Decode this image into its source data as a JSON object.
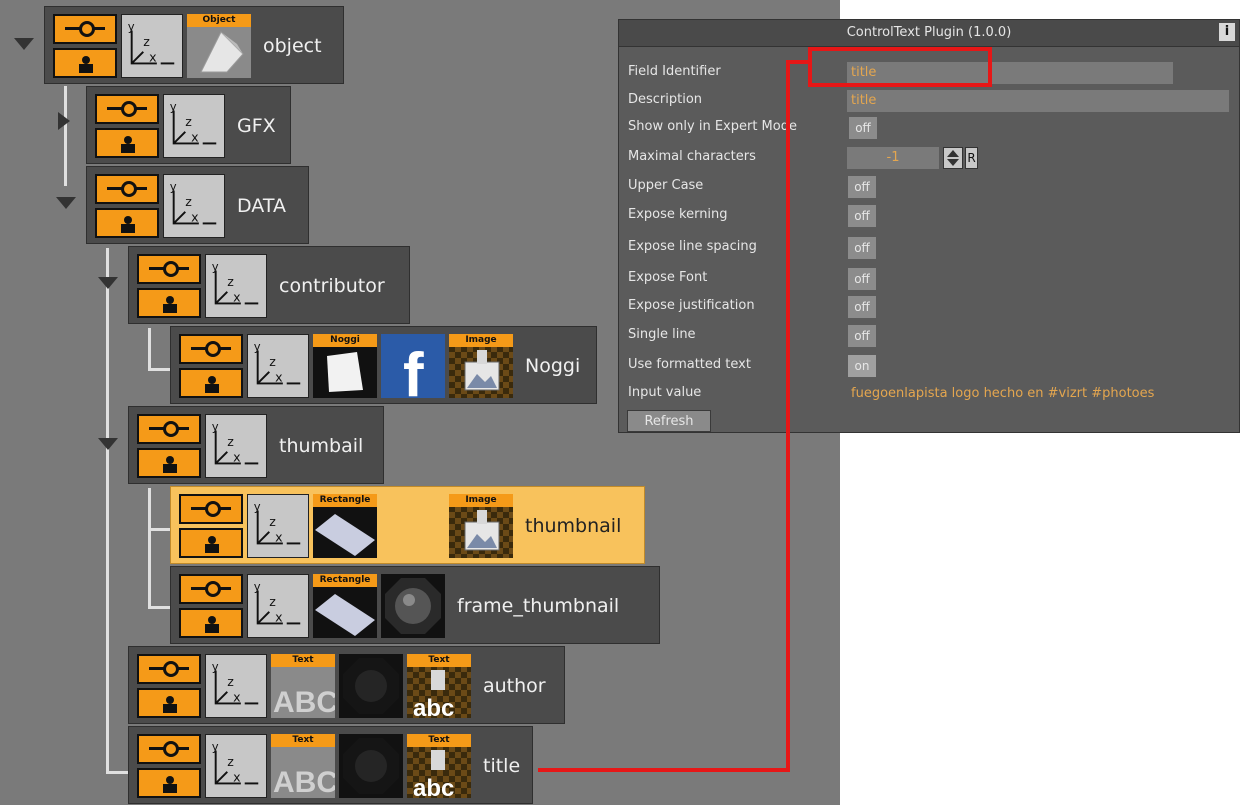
{
  "tree": {
    "nodes": [
      {
        "label": "object",
        "thumbs": [
          {
            "tag": "Object"
          }
        ]
      },
      {
        "label": "GFX",
        "thumbs": []
      },
      {
        "label": "DATA",
        "thumbs": []
      },
      {
        "label": "contributor",
        "thumbs": []
      },
      {
        "label": "Noggi",
        "thumbs": [
          {
            "tag": "Noggi"
          },
          {
            "tag": ""
          },
          {
            "tag": "Image"
          }
        ]
      },
      {
        "label": "thumbail",
        "thumbs": []
      },
      {
        "label": "thumbnail",
        "thumbs": [
          {
            "tag": "Rectangle"
          },
          {
            "tag": "Image"
          }
        ]
      },
      {
        "label": "frame_thumbnail",
        "thumbs": [
          {
            "tag": "Rectangle"
          },
          {
            "tag": ""
          }
        ]
      },
      {
        "label": "author",
        "thumbs": [
          {
            "tag": "Text"
          },
          {
            "tag": ""
          },
          {
            "tag": "Text"
          }
        ]
      },
      {
        "label": "title",
        "thumbs": [
          {
            "tag": "Text"
          },
          {
            "tag": ""
          },
          {
            "tag": "Text"
          }
        ]
      }
    ],
    "axis_text": {
      "y": "y",
      "z": "z",
      "x": "x"
    },
    "text_thumb_abc": "ABC",
    "text_thumb_small": "abc",
    "facebook_glyph": "f"
  },
  "panel": {
    "title": "ControlText Plugin (1.0.0)",
    "info_label": "i",
    "fields": [
      {
        "label": "Field Identifier",
        "value": "title"
      },
      {
        "label": "Description",
        "value": "title"
      },
      {
        "label": "Show only in Expert Mode",
        "value": "off"
      },
      {
        "label": "Maximal characters",
        "value": "-1",
        "r_label": "R"
      },
      {
        "label": "Upper Case",
        "value": "off"
      },
      {
        "label": "Expose kerning",
        "value": "off"
      },
      {
        "label": "Expose line spacing",
        "value": "off"
      },
      {
        "label": "Expose Font",
        "value": "off"
      },
      {
        "label": "Expose justification",
        "value": "off"
      },
      {
        "label": "Single line",
        "value": "off"
      },
      {
        "label": "Use formatted text",
        "value": "on"
      },
      {
        "label": "Input value",
        "value": "fuegoenlapista logo hecho en #vizrt #photoes"
      }
    ],
    "refresh_label": "Refresh"
  },
  "colors": {
    "accent": "#f59a18",
    "highlight": "#e61717",
    "value_text": "#e4a64f"
  }
}
